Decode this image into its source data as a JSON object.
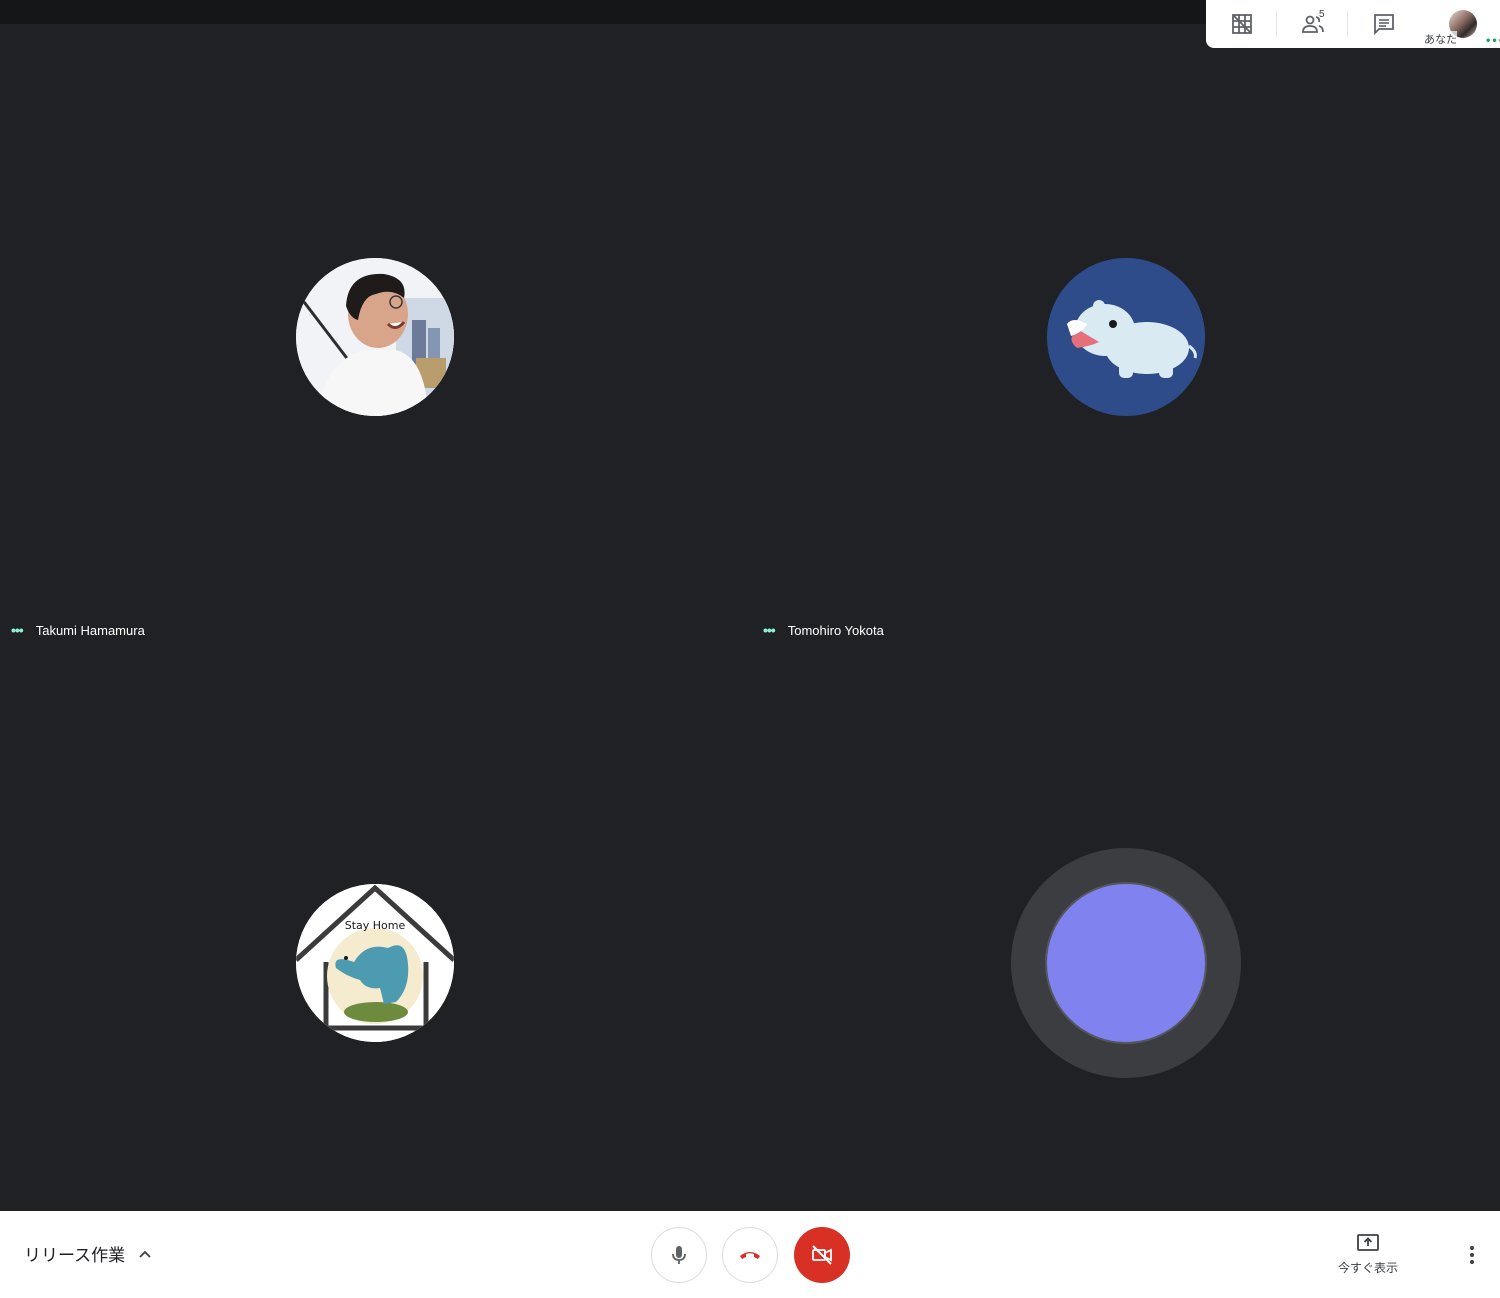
{
  "topbar": {
    "grid_icon": "grid-off-icon",
    "people_icon": "people-icon",
    "people_count": "5",
    "chat_icon": "chat-icon",
    "self_label": "あなた",
    "self_dots": "•••"
  },
  "tiles": [
    {
      "name": "Takumi Hamamura",
      "dots": "•••"
    },
    {
      "name": "Tomohiro Yokota",
      "dots": "•••"
    },
    {
      "avatar_text": "Stay Home"
    }
  ],
  "bottombar": {
    "meeting_title": "リリース作業",
    "present_label": "今すぐ表示",
    "colors": {
      "hangup": "#d93025",
      "self_avatar": "#7f82ef",
      "speaking_dots": "#8ef0da"
    }
  }
}
